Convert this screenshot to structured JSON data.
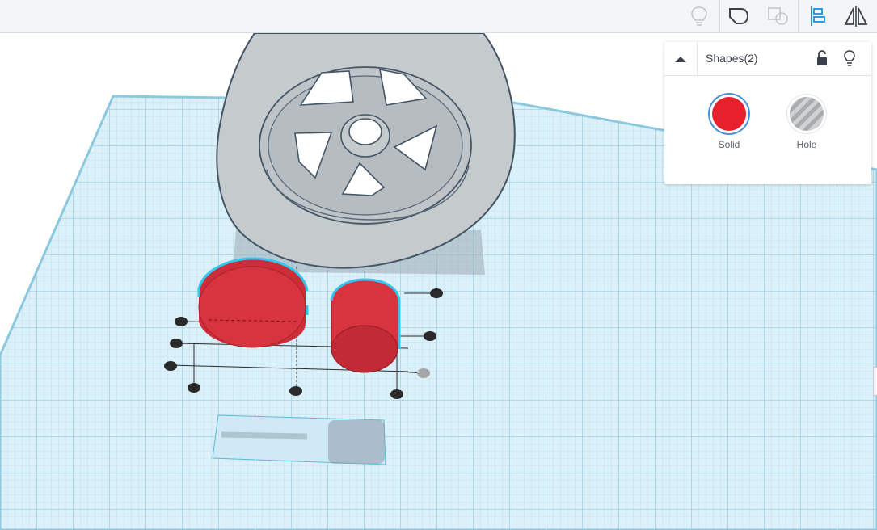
{
  "toolbar": {
    "buttons": [
      {
        "icon": "lightbulb-icon",
        "enabled": false
      },
      {
        "icon": "group-shape-icon",
        "enabled": true
      },
      {
        "icon": "ungroup-shape-icon",
        "enabled": false
      },
      {
        "icon": "align-icon",
        "enabled": true
      },
      {
        "icon": "mirror-icon",
        "enabled": true
      }
    ]
  },
  "inspector": {
    "title": "Shapes(2)",
    "collapse_icon": "caret-up-icon",
    "lock_icon": "unlock-icon",
    "light_icon": "lightbulb-icon",
    "options": [
      {
        "label": "Solid",
        "color": "#e8202e",
        "selected": true
      },
      {
        "label": "Hole",
        "color": "#a9abae",
        "selected": false
      }
    ]
  },
  "scene": {
    "objects": [
      "wheel",
      "red-cylinder-large",
      "red-cylinder-small"
    ],
    "colors": {
      "grid_plane": "#d8eef8",
      "grid_line": "#9fd2e6",
      "wheel": "#c5cacd",
      "wheel_outline": "#445566",
      "solid_red": "#e23d48",
      "selection_outline": "#2ec8f0",
      "handle": "#2a2a2a"
    }
  }
}
